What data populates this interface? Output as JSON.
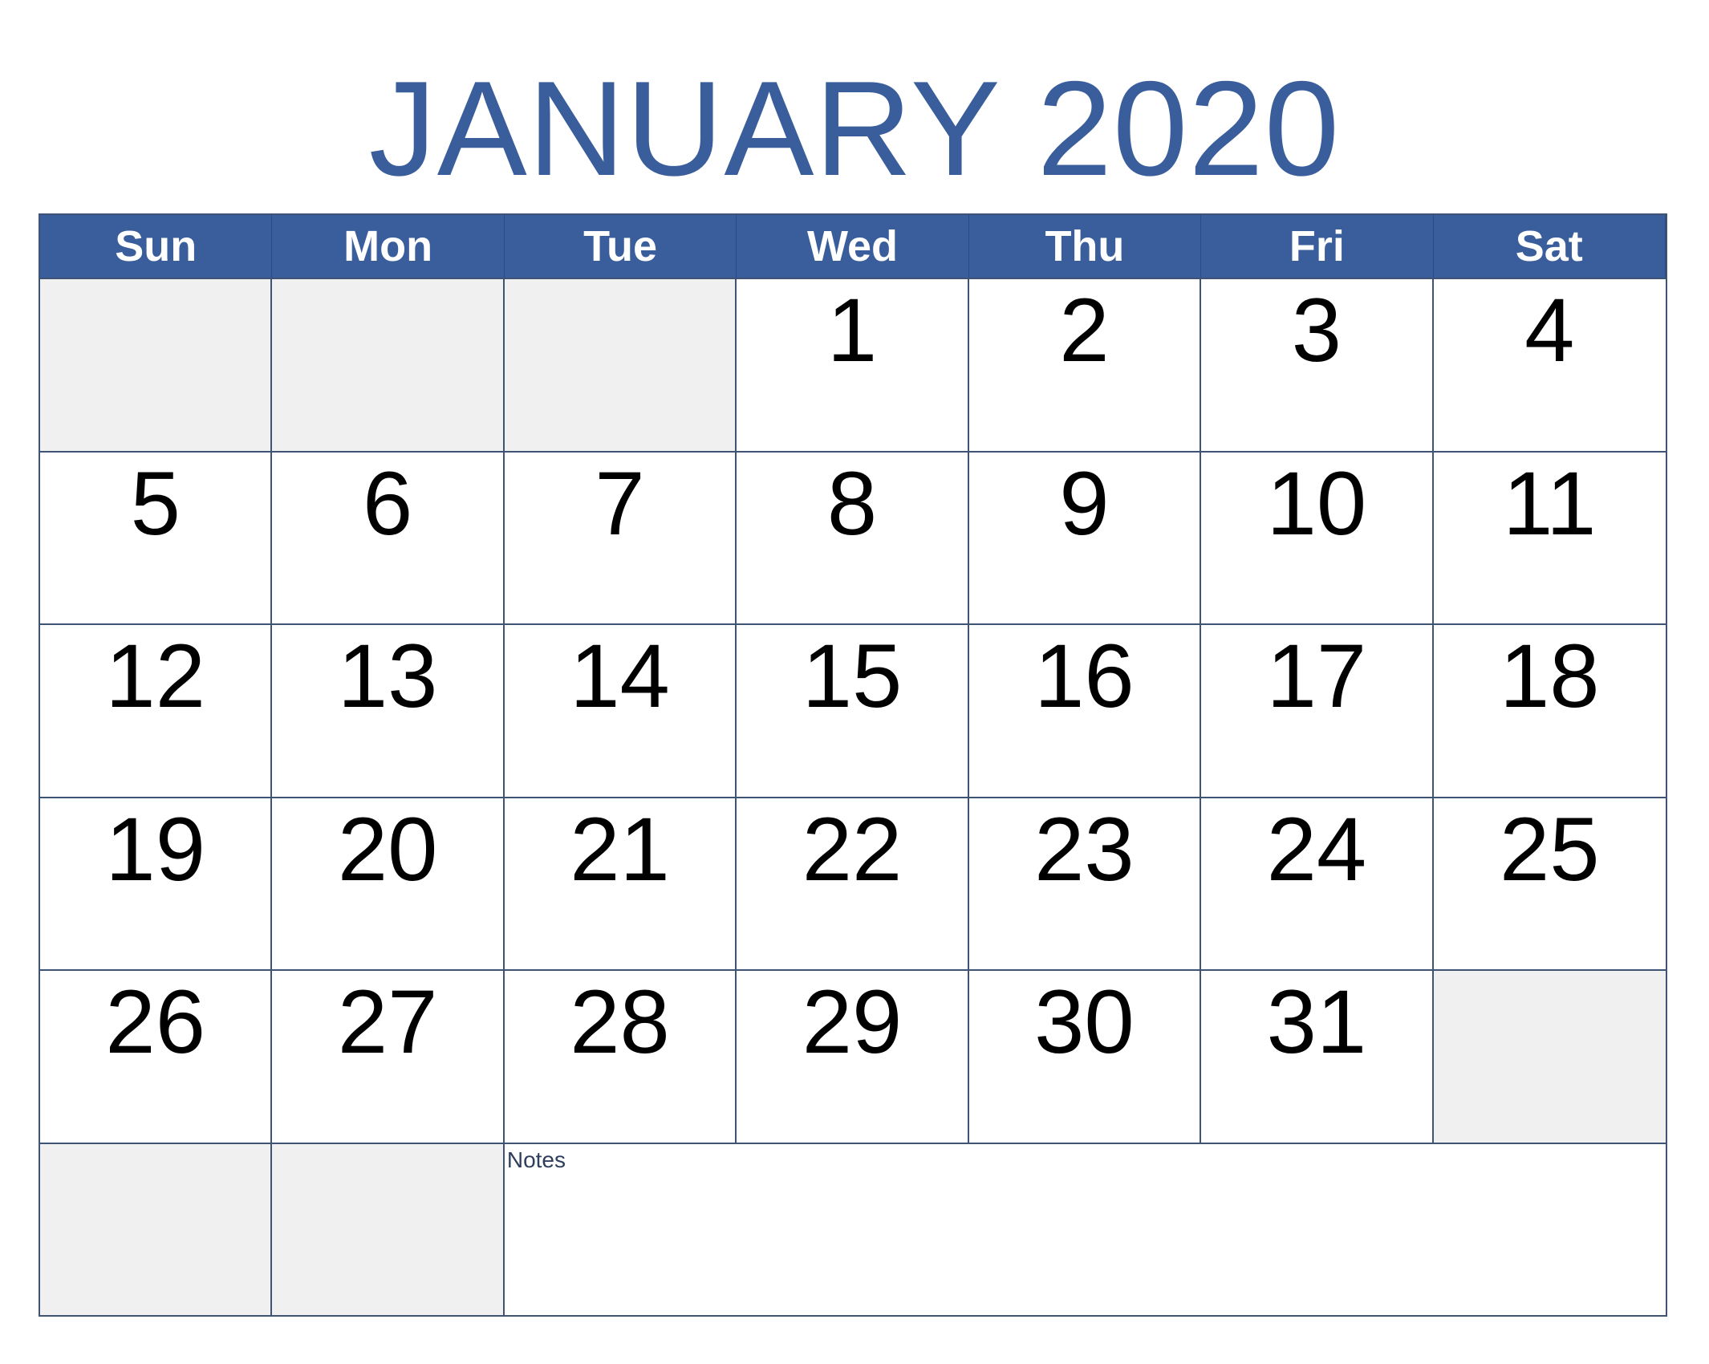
{
  "calendar": {
    "title": "JANUARY 2020",
    "accent_color": "#3a5d9c",
    "weekdays": [
      "Sun",
      "Mon",
      "Tue",
      "Wed",
      "Thu",
      "Fri",
      "Sat"
    ],
    "weeks": [
      [
        "",
        "",
        "",
        "1",
        "2",
        "3",
        "4"
      ],
      [
        "5",
        "6",
        "7",
        "8",
        "9",
        "10",
        "11"
      ],
      [
        "12",
        "13",
        "14",
        "15",
        "16",
        "17",
        "18"
      ],
      [
        "19",
        "20",
        "21",
        "22",
        "23",
        "24",
        "25"
      ],
      [
        "26",
        "27",
        "28",
        "29",
        "30",
        "31",
        ""
      ]
    ],
    "notes_label": "Notes"
  }
}
